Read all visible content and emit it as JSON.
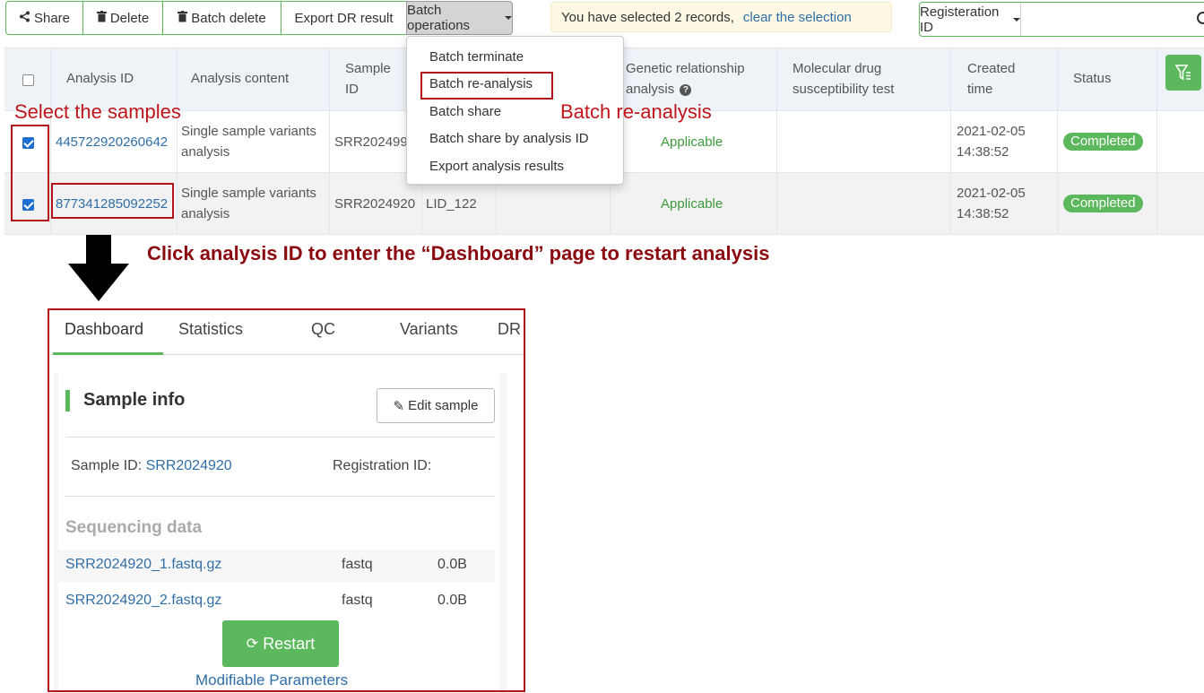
{
  "toolbar": {
    "share": "Share",
    "delete": "Delete",
    "batch_delete": "Batch delete",
    "export_dr": "Export DR result",
    "batch_ops": "Batch operations"
  },
  "selection": {
    "text": "You have selected 2 records,",
    "clear": "clear the selection"
  },
  "search": {
    "field": "Registeration ID",
    "value": ""
  },
  "table": {
    "headers": {
      "analysis_id": "Analysis ID",
      "analysis_content": "Analysis content",
      "sample_id_1": "Sample",
      "sample_id_2": "ID",
      "genetic_1": "Genetic relationship",
      "genetic_2": "analysis",
      "molecular_1": "Molecular drug",
      "molecular_2": "susceptibility test",
      "created_1": "Created",
      "created_2": "time",
      "status": "Status"
    },
    "rows": [
      {
        "analysis_id": "445722920260642",
        "content_1": "Single sample variants",
        "content_2": "analysis",
        "sample_id": "SRR202499",
        "lid": "",
        "genetic": "Applicable",
        "date": "2021-02-05",
        "time": "14:38:52",
        "status": "Completed"
      },
      {
        "analysis_id": "877341285092252",
        "content_1": "Single sample variants",
        "content_2": "analysis",
        "sample_id": "SRR2024920",
        "lid": "LID_122",
        "genetic": "Applicable",
        "date": "2021-02-05",
        "time": "14:38:52",
        "status": "Completed"
      }
    ]
  },
  "dropdown": {
    "items": [
      "Batch terminate",
      "Batch re-analysis",
      "Batch share",
      "Batch share by analysis ID",
      "Export analysis results"
    ]
  },
  "annotations": {
    "select_samples": "Select the samples",
    "batch_reanalysis": "Batch re-analysis",
    "click_hint": "Click analysis ID to enter the “Dashboard” page to restart analysis"
  },
  "dashboard": {
    "tabs": [
      "Dashboard",
      "Statistics",
      "QC",
      "Variants",
      "DR"
    ],
    "sample_info": "Sample info",
    "edit_sample": "Edit sample",
    "sample_id_label": "Sample ID:",
    "sample_id_value": "SRR2024920",
    "registration_label": "Registration ID:",
    "seq_title": "Sequencing data",
    "files": [
      {
        "name": "SRR2024920_1.fastq.gz",
        "type": "fastq",
        "size": "0.0B"
      },
      {
        "name": "SRR2024920_2.fastq.gz",
        "type": "fastq",
        "size": "0.0B"
      }
    ],
    "restart": "Restart",
    "modifiable": "Modifiable Parameters"
  }
}
